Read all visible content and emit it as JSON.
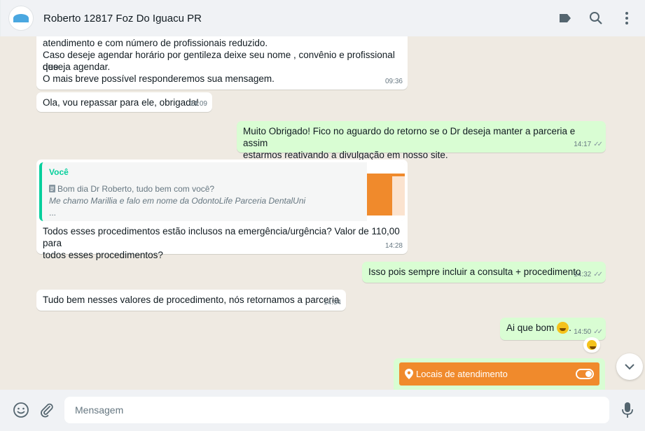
{
  "header": {
    "title": "Roberto 12817 Foz Do Iguacu PR"
  },
  "messages": {
    "m1": {
      "line_cut": "atendimento e com número de profissionais reduzido.",
      "line2": "Caso deseje agendar horário por gentileza deixe seu nome , convênio e profissional que",
      "line3": "deseja agendar.",
      "line4": "O mais breve possível responderemos sua mensagem.",
      "time": "09:36"
    },
    "m2": {
      "text": "Ola, vou repassar para ele, obrigada!",
      "time": "14:09"
    },
    "m3": {
      "line1": "Muito Obrigado! Fico no aguardo do retorno se o Dr deseja manter a parceria e assim",
      "line2": "estarmos reativando a divulgação em nosso site.",
      "time": "14:17"
    },
    "m4": {
      "quote_author": "Você",
      "quote_line1": "Bom dia Dr Roberto, tudo bem com você?",
      "quote_line2": "Me chamo Marillia e falo em nome da OdontoLife Parceria DentalUni",
      "quote_line3": "...",
      "line1": "Todos esses procedimentos estão inclusos na emergência/urgência? Valor de 110,00 para",
      "line2": "todos esses procedimentos?",
      "time": "14:28"
    },
    "m5": {
      "text": "Isso pois sempre incluir a consulta + procedimento",
      "time": "14:32"
    },
    "m6": {
      "text": "Tudo bem nesses valores de procedimento, nós retornamos a parceria",
      "time": "14:34"
    },
    "m7": {
      "text": "Ai que bom",
      "suffix": ".",
      "time": "14:50"
    },
    "card": {
      "label": "Locais de atendimento"
    }
  },
  "composer": {
    "placeholder": "Mensagem"
  },
  "colors": {
    "incoming": "#ffffff",
    "outgoing": "#d9fdd3",
    "accent_orange": "#f08a2c",
    "quote_green": "#06cf9c",
    "background": "#efeae2"
  },
  "icons": [
    "label-icon",
    "search-icon",
    "menu-icon",
    "emoji-icon",
    "attach-icon",
    "mic-icon",
    "chevron-down-icon",
    "location-icon",
    "document-icon",
    "double-check-icon"
  ]
}
